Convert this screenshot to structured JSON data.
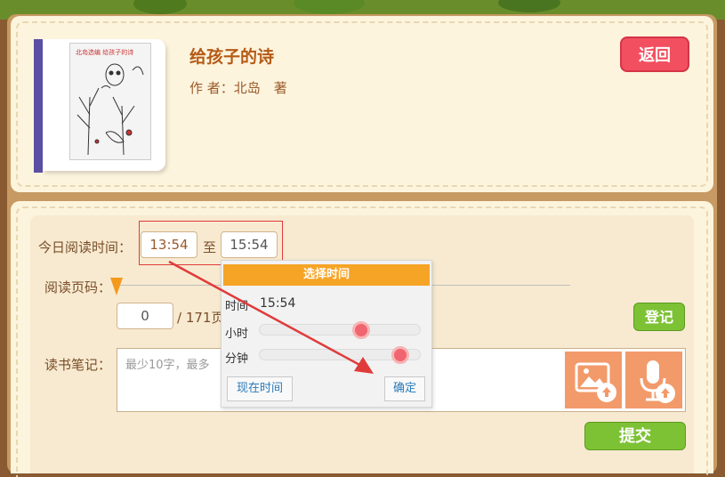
{
  "book": {
    "title": "给孩子的诗",
    "author": "作 者：北岛　著",
    "cover_text": "北岛选编  给孩子的诗"
  },
  "header": {
    "back_label": "返回"
  },
  "form": {
    "today_time_label": "今日阅读时间：",
    "start_time": "13:54",
    "to_label": "至",
    "end_time": "15:54",
    "page_label": "阅读页码：",
    "page_value": "0",
    "page_total": "/ 171页",
    "register_label": "登记",
    "notes_label": "读书笔记：",
    "notes_placeholder": "最少10字，最多",
    "submit_label": "提交"
  },
  "time_picker": {
    "header": "选择时间",
    "time_label": "时间",
    "time_value": "15:54",
    "hour_label": "小时",
    "minute_label": "分钟",
    "hour_value_fraction": 0.65,
    "minute_value_fraction": 0.92,
    "now_button": "现在时间",
    "confirm_button": "确定"
  },
  "colors": {
    "accent_orange": "#f6a426",
    "back_red": "#f25060",
    "green_button": "#7dc235",
    "media_orange": "#f29a6a",
    "annotation_red": "#e03b3b"
  },
  "icons": {
    "image_upload": "image-upload-icon",
    "audio_upload": "microphone-upload-icon",
    "page_slider_thumb": "triangle-thumb"
  }
}
